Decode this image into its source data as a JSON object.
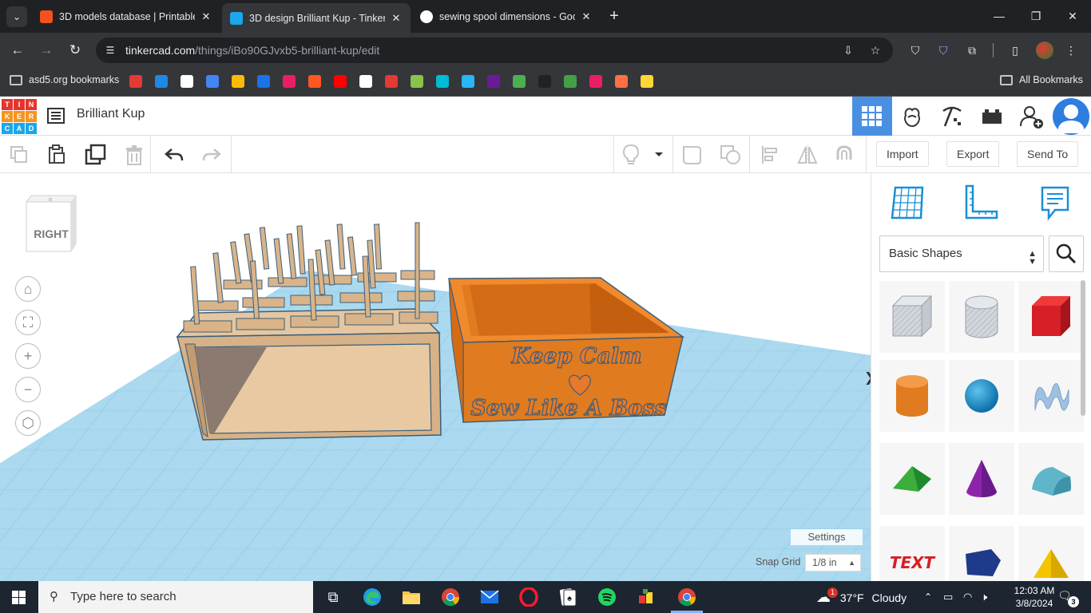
{
  "browser": {
    "tabs": [
      {
        "title": "3D models database | Printable",
        "favicon_color": "#f4511e",
        "active": false
      },
      {
        "title": "3D design Brilliant Kup - Tinker",
        "favicon_color": "#1aa7ec",
        "active": true
      },
      {
        "title": "sewing spool dimensions - Goo",
        "favicon_color": "#ffffff",
        "active": false
      }
    ],
    "url_host": "tinkercad.com",
    "url_path": "/things/iBo90GJvxb5-brilliant-kup/edit",
    "bookmarks_folder": "asd5.org bookmarks",
    "all_bookmarks": "All Bookmarks",
    "bookmark_colors": [
      "#e53935",
      "#1e88e5",
      "#ffffff",
      "#4285f4",
      "#fbbc04",
      "#1a73e8",
      "#e91e63",
      "#ff5722",
      "#ff0000",
      "#ffffff",
      "#e53935",
      "#8bc34a",
      "#00bcd4",
      "#29b6f6",
      "#6a1b9a",
      "#4caf50",
      "#222222",
      "#43a047",
      "#e91e63",
      "#ff7043",
      "#fdd835"
    ]
  },
  "tinkercad": {
    "logo_letters": [
      "T",
      "I",
      "N",
      "K",
      "E",
      "R",
      "C",
      "A",
      "D"
    ],
    "logo_colors": [
      "#e5352b",
      "#e5352b",
      "#e5352b",
      "#f7941d",
      "#f7941d",
      "#f7941d",
      "#1aa7ec",
      "#1aa7ec",
      "#1aa7ec"
    ],
    "design_title": "Brilliant Kup",
    "toolbar": {
      "import_label": "Import",
      "export_label": "Export",
      "send_to_label": "Send To"
    },
    "viewcube_label": "RIGHT",
    "settings_label": "Settings",
    "snap_grid_label": "Snap Grid",
    "snap_grid_value": "1/8 in",
    "design_text_line1": "Keep Calm",
    "design_text_line2": "Sew Like A Boss",
    "shapes_category": "Basic Shapes",
    "colors": {
      "accent_blue": "#4a90e2",
      "grid_blue": "#9fd4ee",
      "wood": "#d9b48a",
      "orange_box": "#e07b20"
    }
  },
  "taskbar": {
    "search_placeholder": "Type here to search",
    "weather_temp": "37°F",
    "weather_condition": "Cloudy",
    "weather_badge": "1",
    "time": "12:03 AM",
    "date": "3/8/2024",
    "notification_count": "3"
  }
}
